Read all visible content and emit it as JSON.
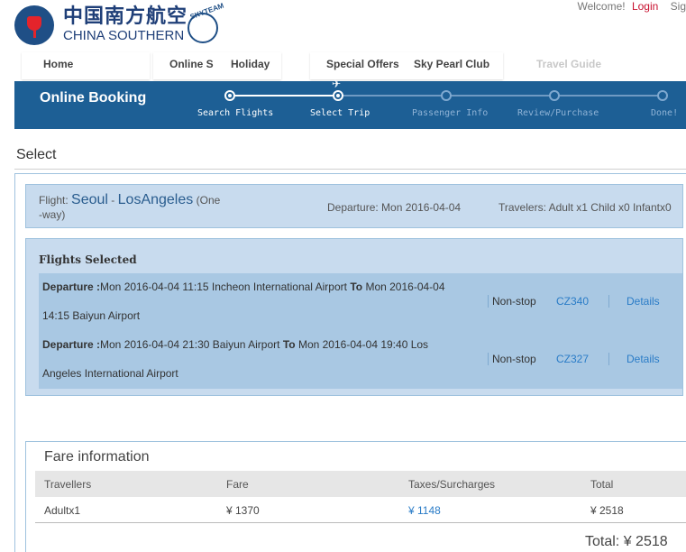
{
  "header": {
    "logo_cn": "中国南方航空",
    "logo_en": "CHINA SOUTHERN",
    "skyteam": "SKYTEAM",
    "welcome": "Welcome!",
    "login": "Login",
    "sign": "Sig"
  },
  "nav": {
    "home": "Home",
    "online": "Online S",
    "holiday": "Holiday",
    "special": "Special Offers",
    "skypearl": "Sky Pearl Club",
    "travel": "Travel Guide"
  },
  "banner": {
    "title": "Online Booking",
    "steps": [
      "Search Flights",
      "Select Trip",
      "Passenger Info",
      "Review/Purchase",
      "Done!"
    ],
    "active_step": 2
  },
  "page_title": "Select",
  "flight_summary": {
    "flight_label": "Flight:",
    "origin": "Seoul",
    "dash": "-",
    "destination": "LosAngeles",
    "oneway_a": "(One",
    "oneway_b": "-way)",
    "departure_label": "Departure:",
    "departure_value": "Mon 2016-04-04",
    "travelers_label": "Travelers:",
    "travelers_value": "Adult x1 Child x0 Infantx0"
  },
  "selected": {
    "title": "Flights Selected",
    "segments": [
      {
        "dep_label": "Departure :",
        "dep_text": "Mon  2016-04-04 11:15  Incheon International Airport ",
        "to": "To",
        "arr_text_a": " Mon  2016-04-04",
        "arr_text_b": "14:15  Baiyun Airport",
        "stop": "Non-stop",
        "flight_no": "CZ340",
        "details": "Details"
      },
      {
        "dep_label": "Departure :",
        "dep_text": "Mon  2016-04-04 21:30  Baiyun Airport ",
        "to": "To",
        "arr_text_a": " Mon  2016-04-04 19:40  Los",
        "arr_text_b": "Angeles International Airport",
        "stop": "Non-stop",
        "flight_no": "CZ327",
        "details": "Details"
      }
    ]
  },
  "fare": {
    "title": "Fare information",
    "headers": [
      "Travellers",
      "Fare",
      "Taxes/Surcharges",
      "Total"
    ],
    "row": [
      "Adultx1",
      "¥ 1370",
      "¥ 1148",
      "¥ 2518"
    ],
    "total_label": "Total:",
    "total_value": "¥ 2518"
  }
}
